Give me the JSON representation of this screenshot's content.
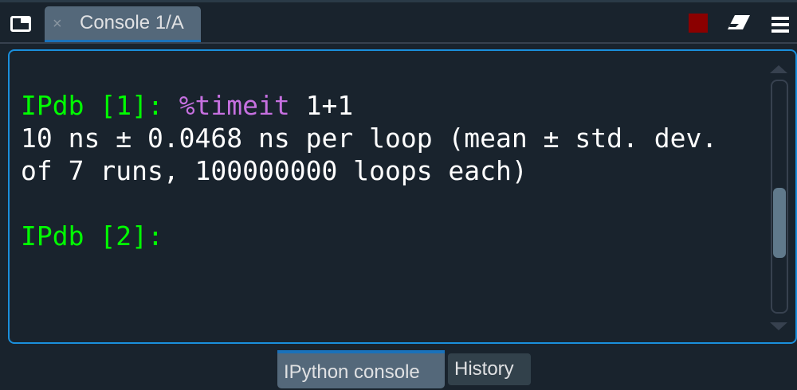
{
  "header": {
    "tab_label": "Console 1/A",
    "close_icon": "×",
    "icons": [
      "window-icon",
      "stop-icon",
      "eraser-icon",
      "menu-icon"
    ],
    "stop_color": "#8b0000"
  },
  "console": {
    "lines": [
      {
        "prompt": "IPdb [1]: ",
        "magic": "%timeit",
        "code": " 1+1"
      },
      {
        "text": "10 ns ± 0.0468 ns per loop (mean ± std. dev."
      },
      {
        "text": "of 7 runs, 100000000 loops each)"
      },
      {
        "prompt": "IPdb [2]:"
      }
    ],
    "prompt_color": "#00ff00",
    "magic_color": "#c670e0"
  },
  "bottom_tabs": [
    {
      "label": "IPython console",
      "active": true
    },
    {
      "label": "History",
      "active": false
    }
  ]
}
